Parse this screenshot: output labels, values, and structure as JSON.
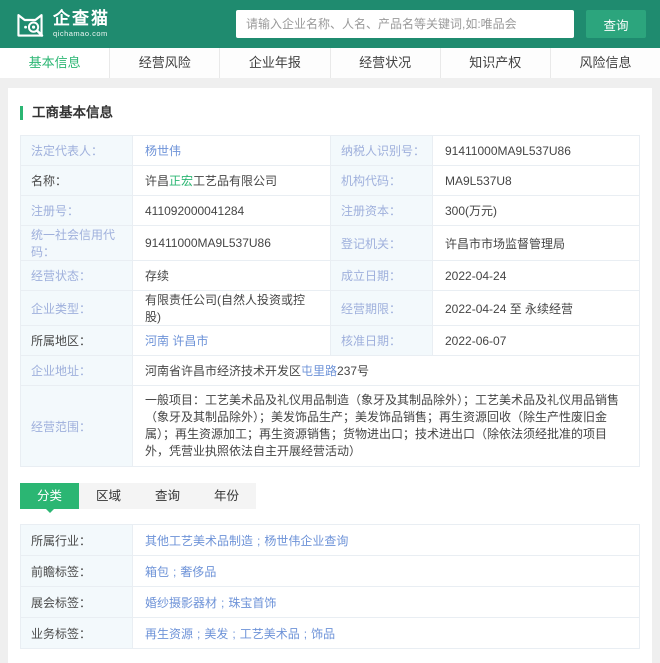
{
  "colors": {
    "header_green": "#1f8b6f",
    "button_green": "#2ca57d",
    "accent_green": "#2bb673",
    "label_blue": "#9fb0dc",
    "link_blue": "#6e93d8"
  },
  "header": {
    "logo_title": "企查猫",
    "logo_domain": "qichamao.com",
    "search_placeholder": "请输入企业名称、人名、产品名等关键词,如:唯品会",
    "search_button_label": "查询"
  },
  "nav": {
    "tabs": [
      {
        "label": "基本信息",
        "active": true
      },
      {
        "label": "经营风险",
        "active": false
      },
      {
        "label": "企业年报",
        "active": false
      },
      {
        "label": "经营状况",
        "active": false
      },
      {
        "label": "知识产权",
        "active": false
      },
      {
        "label": "风险信息",
        "active": false
      }
    ]
  },
  "business_info": {
    "section_title": "工商基本信息",
    "legal_rep": {
      "label": "法定代表人：",
      "value": "杨世伟"
    },
    "taxpayer_id": {
      "label": "纳税人识别号：",
      "value": "91411000MA9L537U86"
    },
    "company_name": {
      "label": "名称：",
      "prefix": "许昌",
      "highlight": "正宏",
      "suffix": "工艺品有限公司"
    },
    "org_code": {
      "label": "机构代码：",
      "value": "MA9L537U8"
    },
    "reg_no": {
      "label": "注册号：",
      "value": "411092000041284"
    },
    "reg_capital": {
      "label": "注册资本：",
      "value": "300(万元)"
    },
    "credit_code": {
      "label": "统一社会信用代码：",
      "value": "91411000MA9L537U86"
    },
    "reg_authority": {
      "label": "登记机关：",
      "value": "许昌市市场监督管理局"
    },
    "status": {
      "label": "经营状态：",
      "value": "存续"
    },
    "establish_date": {
      "label": "成立日期：",
      "value": "2022-04-24"
    },
    "ent_type": {
      "label": "企业类型：",
      "value": "有限责任公司(自然人投资或控股)"
    },
    "term": {
      "label": "经营期限：",
      "value": "2022-04-24 至 永续经营"
    },
    "region": {
      "label": "所属地区：",
      "value": "河南 许昌市"
    },
    "approval_date": {
      "label": "核准日期：",
      "value": "2022-06-07"
    },
    "address": {
      "label": "企业地址：",
      "pre": "河南省许昌市经济技术开发区",
      "link": "屯里路",
      "post": "237号"
    },
    "scope": {
      "label": "经营范围：",
      "value": "一般项目：工艺美术品及礼仪用品制造（象牙及其制品除外）；工艺美术品及礼仪用品销售（象牙及其制品除外）；美发饰品生产；美发饰品销售；再生资源回收（除生产性废旧金属）；再生资源加工；再生资源销售；货物进出口；技术进出口（除依法须经批准的项目外，凭营业执照依法自主开展经营活动）"
    }
  },
  "filter": {
    "tabs": [
      {
        "label": "分类",
        "active": true
      },
      {
        "label": "区域",
        "active": false
      },
      {
        "label": "查询",
        "active": false
      },
      {
        "label": "年份",
        "active": false
      }
    ]
  },
  "tags": {
    "separator": ";",
    "industry": {
      "label": "所属行业：",
      "links": [
        "其他工艺美术品制造",
        "杨世伟企业查询"
      ]
    },
    "qianzhan": {
      "label": "前瞻标签：",
      "links": [
        "箱包",
        "奢侈品"
      ]
    },
    "expo": {
      "label": "展会标签：",
      "links": [
        "婚纱摄影器材",
        "珠宝首饰"
      ]
    },
    "business": {
      "label": "业务标签：",
      "links": [
        "再生资源",
        "美发",
        "工艺美术品",
        "饰品"
      ]
    }
  }
}
